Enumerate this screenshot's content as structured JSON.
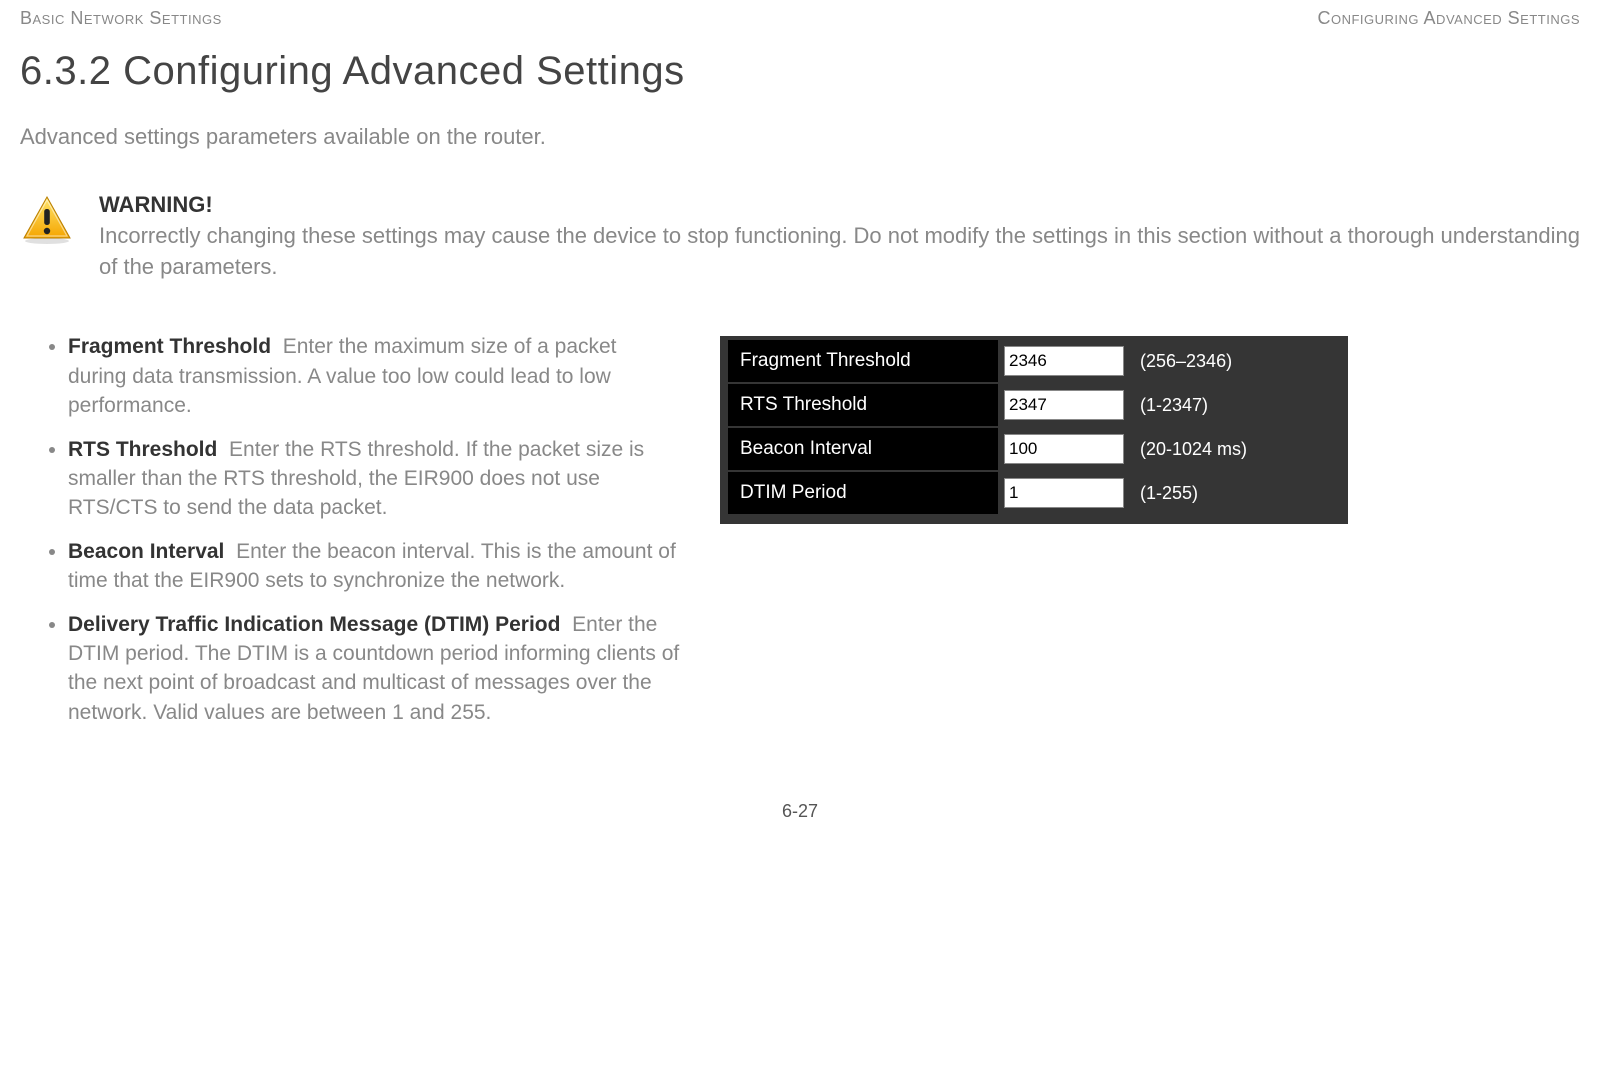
{
  "header": {
    "left": "Basic Network Settings",
    "right": "Configuring Advanced Settings"
  },
  "section_title": "6.3.2 Configuring Advanced Settings",
  "intro": "Advanced settings parameters available on the router.",
  "warning": {
    "title": "WARNING!",
    "body": "Incorrectly changing these settings may cause the device to stop functioning. Do not modify the settings in this section without a thorough understanding of the parameters."
  },
  "bullets": [
    {
      "term": "Fragment Threshold",
      "desc": "Enter the maximum size of a packet during data transmission. A value too low could lead to low performance."
    },
    {
      "term": "RTS Threshold",
      "desc": "Enter the RTS threshold.  If the packet size is smaller than the RTS threshold, the EIR900 does not use RTS/CTS to send the data packet."
    },
    {
      "term": "Beacon Interval",
      "desc": "Enter the beacon interval. This is the amount of time that the EIR900 sets to synchronize the network."
    },
    {
      "term": "Delivery Traffic Indication Message (DTIM) Period",
      "desc": "Enter the DTIM period. The DTIM is a countdown period informing clients of the next point of broadcast and multicast of messages over the network. Valid values are between 1 and 255."
    }
  ],
  "settings": [
    {
      "label": "Fragment Threshold",
      "value": "2346",
      "hint": "(256–2346)"
    },
    {
      "label": "RTS Threshold",
      "value": "2347",
      "hint": "(1-2347)"
    },
    {
      "label": "Beacon Interval",
      "value": "100",
      "hint": "(20-1024 ms)"
    },
    {
      "label": "DTIM Period",
      "value": "1",
      "hint": "(1-255)"
    }
  ],
  "page_number": "6-27"
}
